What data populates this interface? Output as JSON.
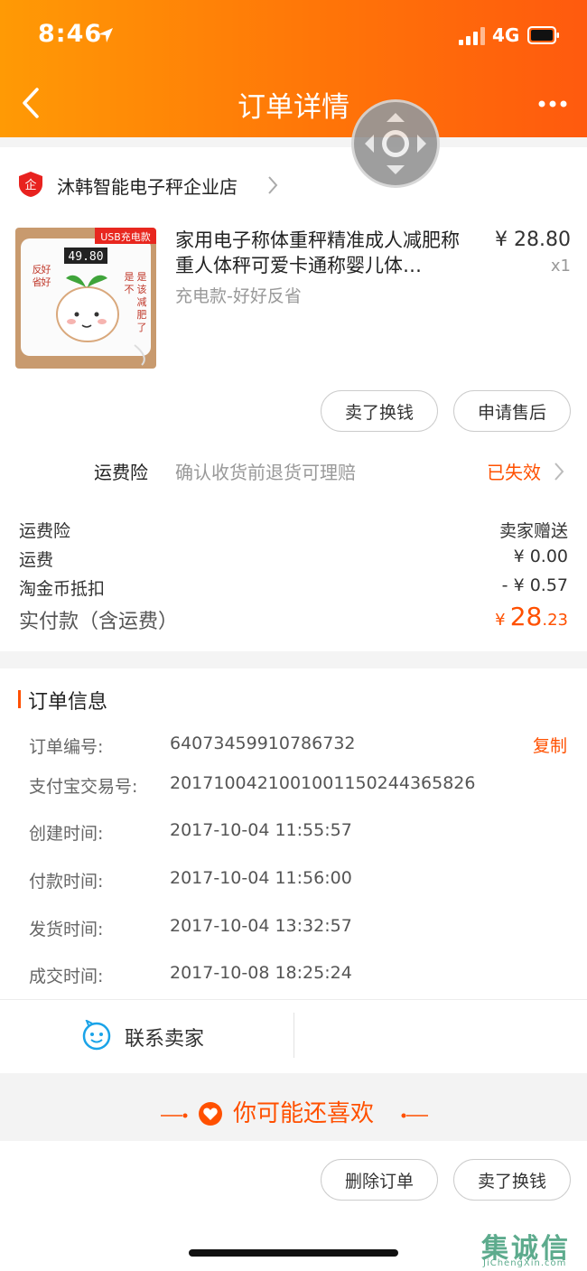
{
  "status_bar": {
    "time": "8:46",
    "network": "4G"
  },
  "nav": {
    "title": "订单详情"
  },
  "shop": {
    "name": "沐韩智能电子秤企业店",
    "badge": "企"
  },
  "product": {
    "title": "家用电子称体重秤精准成人减肥称重人体秤可爱卡通称婴儿体…",
    "variant": "充电款-好好反省",
    "price": "¥ 28.80",
    "quantity": "x1",
    "image": {
      "badge": "USB充电款",
      "display": "49.80",
      "side_text": "是不是该减肥了",
      "left_text": "好好反省"
    }
  },
  "actions": {
    "sell": "卖了换钱",
    "after_sale": "申请售后"
  },
  "insurance": {
    "label": "运费险",
    "description": "确认收货前退货可理赔",
    "status": "已失效"
  },
  "fees": [
    {
      "label": "运费险",
      "value": "卖家赠送"
    },
    {
      "label": "运费",
      "value": "¥ 0.00"
    },
    {
      "label": "淘金币抵扣",
      "value": "- ¥ 0.57"
    }
  ],
  "total": {
    "label": "实付款（含运费）",
    "currency": "¥",
    "integer": "28",
    "decimal": ".23"
  },
  "order_info": {
    "title": "订单信息",
    "copy": "复制",
    "rows": [
      {
        "label": "订单编号:",
        "value": "64073459910786732"
      },
      {
        "label": "支付宝交易号:",
        "value": "2017100421001001150244365826"
      },
      {
        "label": "创建时间:",
        "value": "2017-10-04 11:55:57"
      },
      {
        "label": "付款时间:",
        "value": "2017-10-04 11:56:00"
      },
      {
        "label": "发货时间:",
        "value": "2017-10-04 13:32:57"
      },
      {
        "label": "成交时间:",
        "value": "2017-10-08 18:25:24"
      }
    ]
  },
  "contact": {
    "label": "联系卖家"
  },
  "recommend": {
    "title": "你可能还喜欢"
  },
  "bottom_actions": {
    "delete": "删除订单",
    "sell": "卖了换钱"
  },
  "watermark": {
    "text": "集诚信",
    "sub": "JiChengXin.com"
  },
  "colors": {
    "accent": "#ff5000",
    "header_start": "#ff9a05",
    "header_end": "#ff5a0e"
  }
}
